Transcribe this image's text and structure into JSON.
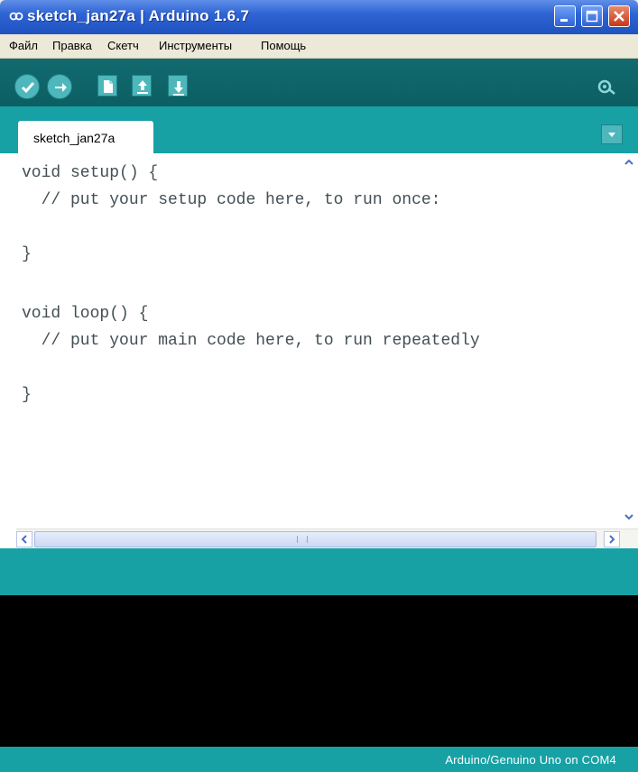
{
  "window": {
    "title": "sketch_jan27a | Arduino 1.6.7"
  },
  "menu": {
    "items": [
      "Файл",
      "Правка",
      "Скетч",
      "Инструменты",
      "Помощь"
    ]
  },
  "toolbar": {
    "buttons": [
      "verify-icon",
      "upload-icon",
      "new-icon",
      "open-icon",
      "save-icon"
    ],
    "right": "serial-monitor-icon"
  },
  "tabs": [
    {
      "label": "sketch_jan27a"
    }
  ],
  "editor": {
    "lines": [
      "void setup() {",
      "  // put your setup code here, to run once:",
      "",
      "}",
      "",
      "void loop() {",
      "  // put your main code here, to run repeatedly",
      "",
      "}"
    ]
  },
  "status": {
    "board": "Arduino/Genuino Uno on COM4"
  },
  "colors": {
    "toolbar": "#0a5c60",
    "accent": "#17a1a5",
    "console": "#000000",
    "button": "#4db7bb"
  }
}
